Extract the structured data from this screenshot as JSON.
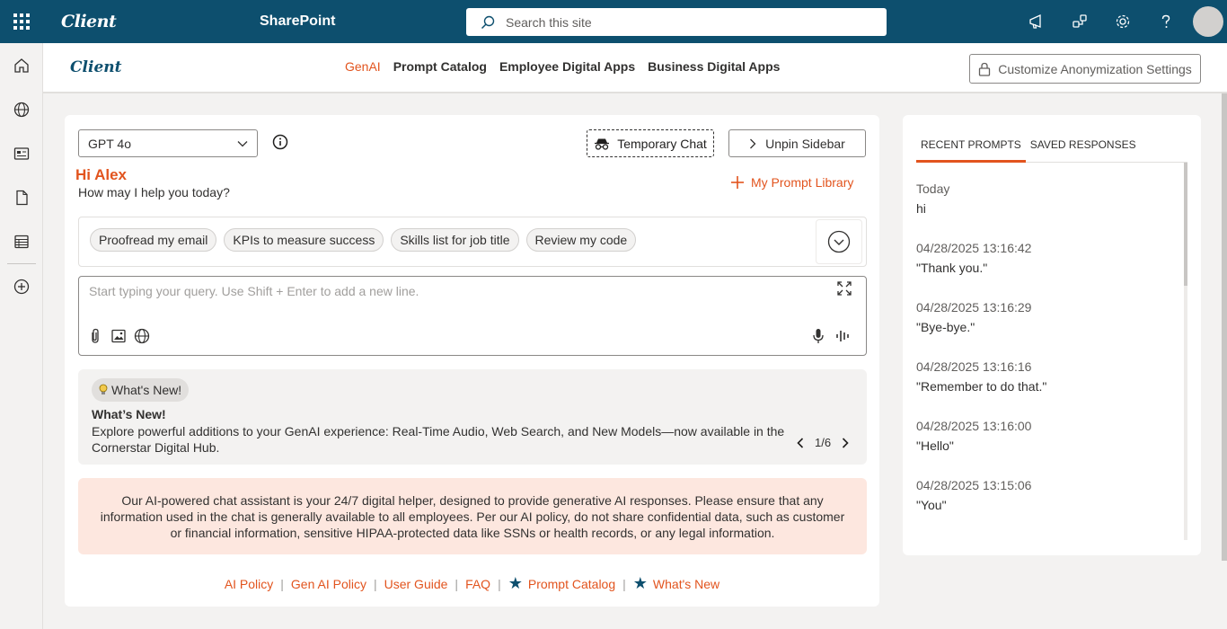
{
  "suitebar": {
    "brand": "Client",
    "app_name": "SharePoint",
    "search_placeholder": "Search this site",
    "icons": [
      "megaphone-icon",
      "share-icon",
      "gear-icon",
      "help-icon",
      "avatar"
    ]
  },
  "leftrail": {
    "items": [
      "home-icon",
      "globe-icon",
      "news-icon",
      "document-icon",
      "list-icon",
      "add-icon"
    ]
  },
  "siteheader": {
    "logo": "Client",
    "nav": [
      {
        "label": "GenAI",
        "active": true
      },
      {
        "label": "Prompt Catalog"
      },
      {
        "label": "Employee Digital Apps"
      },
      {
        "label": "Business Digital Apps"
      }
    ],
    "customize_label": "Customize Anonymization Settings"
  },
  "chat": {
    "model_selected": "GPT 4o",
    "temporary_chat_label": "Temporary Chat",
    "unpin_label": "Unpin Sidebar",
    "greeting": "Hi Alex",
    "subgreeting": "How may I help you today?",
    "prompt_library_label": "My Prompt Library",
    "chips": [
      "Proofread my email",
      "KPIs to measure success",
      "Skills list for job title",
      "Review my code"
    ],
    "query_placeholder": "Start typing your query. Use Shift + Enter to add a new line."
  },
  "whats_new": {
    "badge": "What's New!",
    "title": "What’s New!",
    "text": "Explore powerful additions to your GenAI experience: Real-Time Audio, Web Search, and New Models—now available in the Cornerstar Digital Hub.",
    "pager": "1/6"
  },
  "disclaimer": "Our AI-powered chat assistant is your 24/7 digital helper, designed to provide generative AI responses. Please ensure that any information used in the chat is generally available to all employees. Per our AI policy, do not share confidential data, such as customer or financial information, sensitive HIPAA-protected data like SSNs or health records, or any legal information.",
  "footer": {
    "links": [
      "AI Policy",
      "Gen AI Policy",
      "User Guide",
      "FAQ",
      "Prompt Catalog",
      "What's New"
    ],
    "separator": "|"
  },
  "sidebar": {
    "tabs": [
      "RECENT PROMPTS",
      "SAVED RESPONSES"
    ],
    "items": [
      {
        "date": "Today",
        "text": "hi"
      },
      {
        "date": "04/28/2025 13:16:42",
        "text": "\"Thank you.\""
      },
      {
        "date": "04/28/2025 13:16:29",
        "text": "\"Bye-bye.\""
      },
      {
        "date": "04/28/2025 13:16:16",
        "text": "\"Remember to do that.\""
      },
      {
        "date": "04/28/2025 13:16:00",
        "text": "\"Hello\""
      },
      {
        "date": "04/28/2025 13:15:06",
        "text": "\"You\""
      }
    ]
  },
  "colors": {
    "suitebar": "#0d4f6e",
    "accent": "#e2541e",
    "disclaimer_bg": "#fde7df"
  }
}
